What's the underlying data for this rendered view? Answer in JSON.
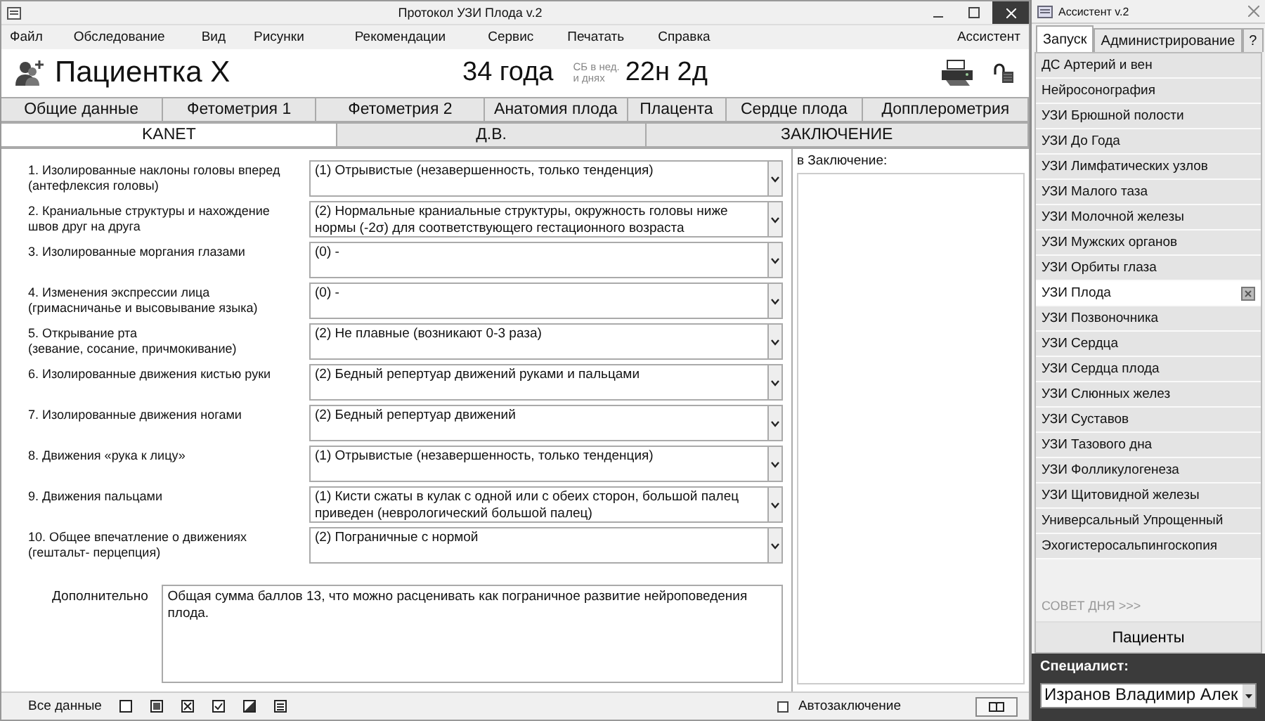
{
  "window": {
    "title": "Протокол УЗИ Плода v.2"
  },
  "menu": [
    "Файл",
    "Обследование",
    "Вид",
    "Рисунки",
    "Рекомендации",
    "Сервис",
    "Печатать",
    "Справка"
  ],
  "menu_right": "Ассистент",
  "header": {
    "patient": "Пациентка X",
    "age": "34 года",
    "term_label_1": "СБ в нед.",
    "term_label_2": "и днях",
    "term": "22н 2д"
  },
  "tabs_row_1": [
    {
      "label": "Общие данные",
      "selected": false
    },
    {
      "label": "Фетометрия 1",
      "selected": false
    },
    {
      "label": "Фетометрия 2",
      "selected": false
    },
    {
      "label": "Анатомия плода",
      "selected": false
    },
    {
      "label": "Плацента",
      "selected": false
    },
    {
      "label": "Сердце плода",
      "selected": false
    },
    {
      "label": "Допплерометрия",
      "selected": false
    }
  ],
  "tabs_row_2": [
    {
      "label": "KANET",
      "selected": true
    },
    {
      "label": "Д.В.",
      "selected": false
    },
    {
      "label": "ЗАКЛЮЧЕНИЕ",
      "selected": false
    }
  ],
  "form": [
    {
      "label": "1. Изолированные наклоны головы вперед\n(антефлексия головы)",
      "value": "(1) Отрывистые (незавершенность, только тенденция)"
    },
    {
      "label": "2. Краниальные структуры и нахождение\n швов друг на друга",
      "value": "(2) Нормальные краниальные структуры, окружность головы ниже нормы (-2σ) для соответствующего гестационного возраста"
    },
    {
      "label": "3. Изолированные моргания глазами",
      "value": "(0) -"
    },
    {
      "label": "4. Изменения экспрессии лица\n(гримасничанье и высовывание языка)",
      "value": "(0) -"
    },
    {
      "label": "5. Открывание рта\n(зевание, сосание, причмокивание)",
      "value": "(2) Не плавные (возникают 0-3 раза)"
    },
    {
      "label": "6. Изолированные движения кистью руки",
      "value": "(2) Бедный репертуар движений руками и пальцами"
    },
    {
      "label": "7. Изолированные движения ногами",
      "value": "(2) Бедный репертуар движений"
    },
    {
      "label": "8. Движения «рука к лицу»",
      "value": "(1) Отрывистые (незавершенность, только тенденция)"
    },
    {
      "label": "9. Движения пальцами",
      "value": "(1) Кисти сжаты в кулак с одной или с обеих сторон, большой палец приведен (неврологический большой палец)"
    },
    {
      "label": "10. Общее впечатление о движениях\n(гештальт- перцепция)",
      "value": "(2) Пограничные с нормой"
    }
  ],
  "additional": {
    "label": "Дополнительно",
    "value": "Общая сумма баллов 13, что можно расценивать как пограничное развитие нейроповедения плода."
  },
  "conclusion": {
    "label": "в Заключение:"
  },
  "footer": {
    "all_data": "Все данные",
    "auto_conclusion": {
      "label": "Автозаключение",
      "checked": false
    }
  },
  "assistant": {
    "title": "Ассистент v.2",
    "tabs": [
      {
        "label": "Запуск",
        "selected": true
      },
      {
        "label": "Администрирование",
        "selected": false
      },
      {
        "label": "?",
        "selected": false
      }
    ],
    "items": [
      {
        "label": "ДС Артерий и вен",
        "selected": false
      },
      {
        "label": "Нейросонография",
        "selected": false
      },
      {
        "label": "УЗИ Брюшной полости",
        "selected": false
      },
      {
        "label": "УЗИ До Года",
        "selected": false
      },
      {
        "label": "УЗИ Лимфатических узлов",
        "selected": false
      },
      {
        "label": "УЗИ Малого таза",
        "selected": false
      },
      {
        "label": "УЗИ Молочной железы",
        "selected": false
      },
      {
        "label": "УЗИ Мужских органов",
        "selected": false
      },
      {
        "label": "УЗИ Орбиты глаза",
        "selected": false
      },
      {
        "label": "УЗИ Плода",
        "selected": true
      },
      {
        "label": "УЗИ Позвоночника",
        "selected": false
      },
      {
        "label": "УЗИ Сердца",
        "selected": false
      },
      {
        "label": "УЗИ Сердца плода",
        "selected": false
      },
      {
        "label": "УЗИ Слюнных желез",
        "selected": false
      },
      {
        "label": "УЗИ Суставов",
        "selected": false
      },
      {
        "label": "УЗИ Тазового дна",
        "selected": false
      },
      {
        "label": "УЗИ Фолликулогенеза",
        "selected": false
      },
      {
        "label": "УЗИ Щитовидной железы",
        "selected": false
      },
      {
        "label": "Универсальный Упрощенный",
        "selected": false
      },
      {
        "label": "Эхогистеросальпингоскопия",
        "selected": false
      }
    ],
    "tip": "СОВЕТ ДНЯ  >>>",
    "patients_button": "Пациенты",
    "specialist_label": "Специалист:",
    "specialist": "Изранов Владимир Алек"
  }
}
